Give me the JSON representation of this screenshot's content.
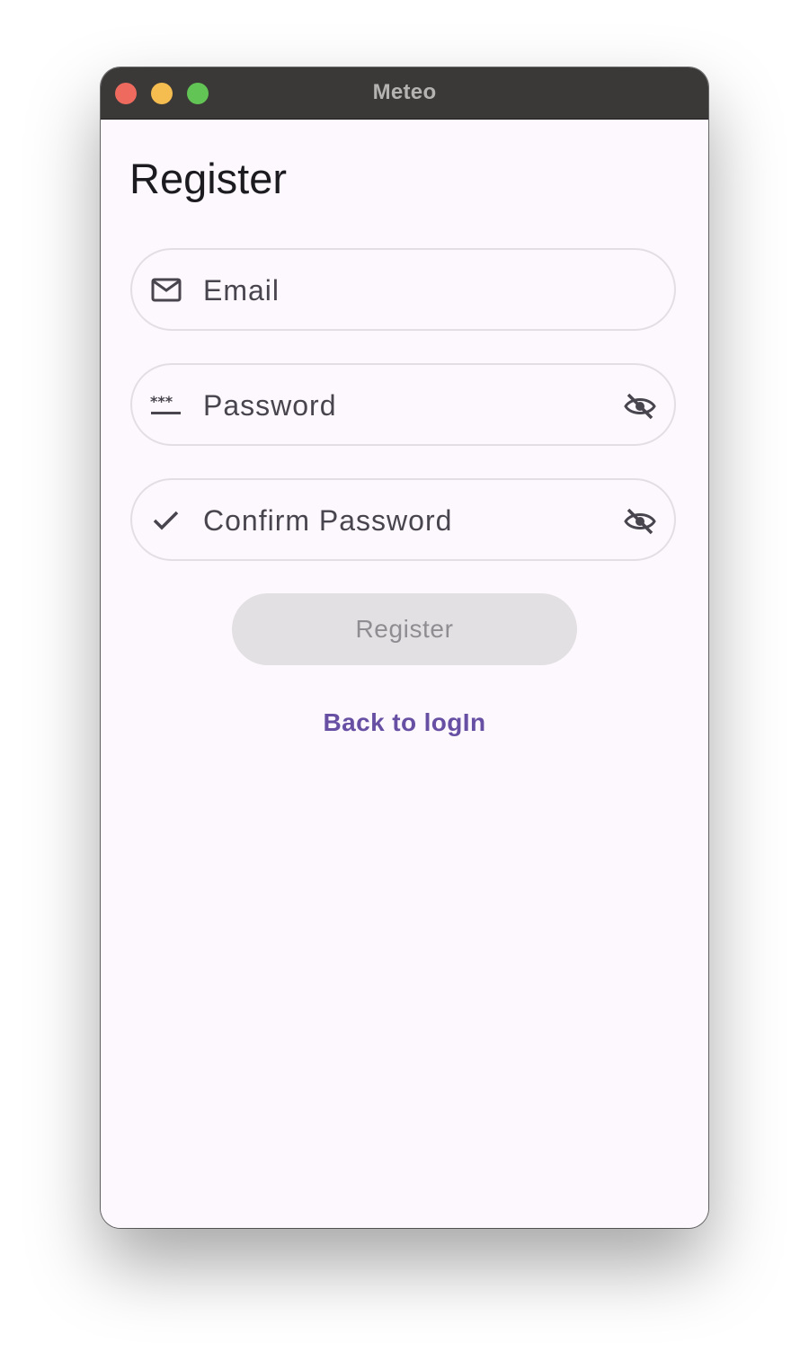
{
  "window": {
    "title": "Meteo"
  },
  "page": {
    "title": "Register"
  },
  "form": {
    "email_label": "Email",
    "password_label": "Password",
    "confirm_label": "Confirm Password",
    "register_label": "Register",
    "back_label": "Back to logIn"
  },
  "icons": {
    "email": "mail-icon",
    "password": "password-icon",
    "confirm": "check-icon",
    "toggle": "visibility-off-icon"
  },
  "colors": {
    "accent": "#6750a4",
    "button_disabled_bg": "#e2e0e3",
    "button_disabled_text": "#8f8d91",
    "background": "#fdf8fd",
    "titlebar": "#3a3938"
  }
}
